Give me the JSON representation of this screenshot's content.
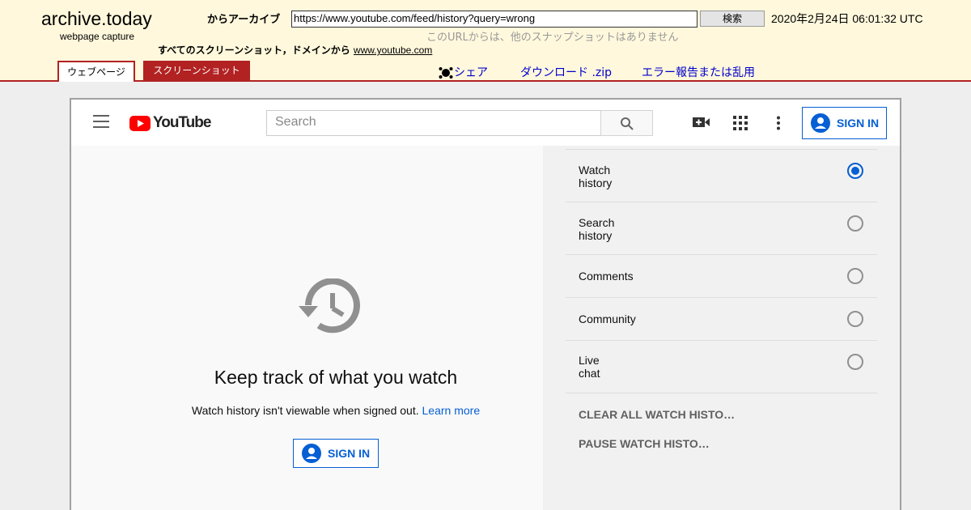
{
  "archive": {
    "logo": "archive.today",
    "subtitle": "webpage capture",
    "from_label": "からアーカイブ",
    "url_value": "https://www.youtube.com/feed/history?query=wrong",
    "search_button": "検索",
    "datetime": "2020年2月24日 06:01:32 UTC",
    "no_other": "このURLからは、他のスナップショットはありません",
    "all_screenshots": "すべてのスクリーンショット，ドメインから",
    "domain_link": "www.youtube.com",
    "tab_webpage": "ウェブページ",
    "tab_screenshot": "スクリーンショット",
    "share": "シェア",
    "download": "ダウンロード .zip",
    "report": "エラー報告または乱用"
  },
  "youtube": {
    "logo_text": "YouTube",
    "search_placeholder": "Search",
    "sign_in": "SIGN IN",
    "headline": "Keep track of what you watch",
    "description": "Watch history isn't viewable when signed out.",
    "learn_more": "Learn more",
    "history_types": [
      {
        "line1": "Watch",
        "line2": "history",
        "selected": true
      },
      {
        "line1": "Search",
        "line2": "history",
        "selected": false
      },
      {
        "line1": "Comments",
        "line2": "",
        "selected": false
      },
      {
        "line1": "Community",
        "line2": "",
        "selected": false
      },
      {
        "line1": "Live",
        "line2": "chat",
        "selected": false
      }
    ],
    "clear_all": "CLEAR ALL WATCH HISTO…",
    "pause": "PAUSE WATCH HISTO…"
  },
  "colors": {
    "archive_bg": "#fff8dc",
    "archive_accent": "#b22222",
    "yt_red": "#ff0000",
    "yt_blue": "#065fd4"
  }
}
